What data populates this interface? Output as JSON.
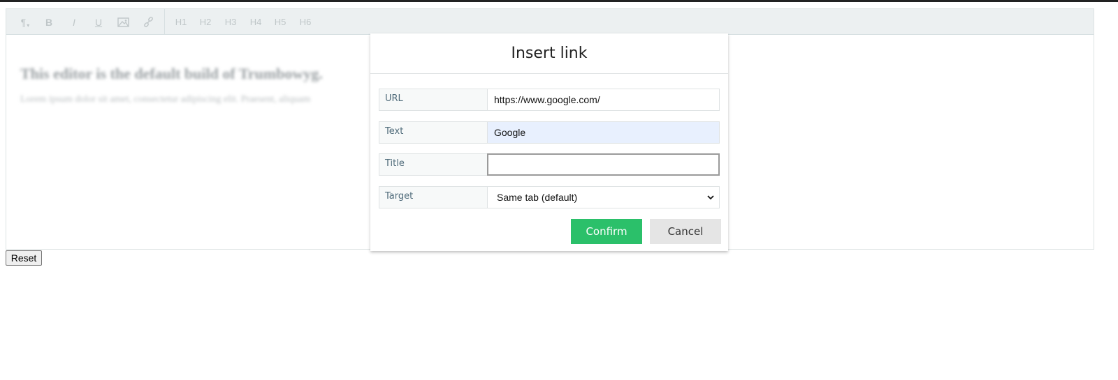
{
  "toolbar": {
    "buttons": [
      {
        "icon": "paragraph-icon",
        "label": "¶"
      },
      {
        "icon": "bold-icon",
        "label": "B"
      },
      {
        "icon": "italic-icon",
        "label": "I"
      },
      {
        "icon": "underline-icon",
        "label": "U"
      },
      {
        "icon": "image-icon",
        "label": ""
      },
      {
        "icon": "link-icon",
        "label": ""
      }
    ],
    "headings": [
      "H1",
      "H2",
      "H3",
      "H4",
      "H5",
      "H6"
    ]
  },
  "editor": {
    "heading": "This editor is the default build of Trumbowyg.",
    "paragraph": "Lorem ipsum dolor sit amet, consectetur adipiscing elit. Praesent, aliquam"
  },
  "reset_label": "Reset",
  "modal": {
    "title": "Insert link",
    "fields": {
      "url": {
        "label": "URL",
        "value": "https://www.google.com/"
      },
      "text": {
        "label": "Text",
        "value": "Google"
      },
      "title": {
        "label": "Title",
        "value": ""
      },
      "target": {
        "label": "Target",
        "value": "Same tab (default)"
      }
    },
    "confirm_label": "Confirm",
    "cancel_label": "Cancel"
  },
  "colors": {
    "confirm": "#2bc06a",
    "cancel": "#e5e5e5",
    "toolbar": "#ecf0f1",
    "autofill": "#e8f0fe"
  }
}
